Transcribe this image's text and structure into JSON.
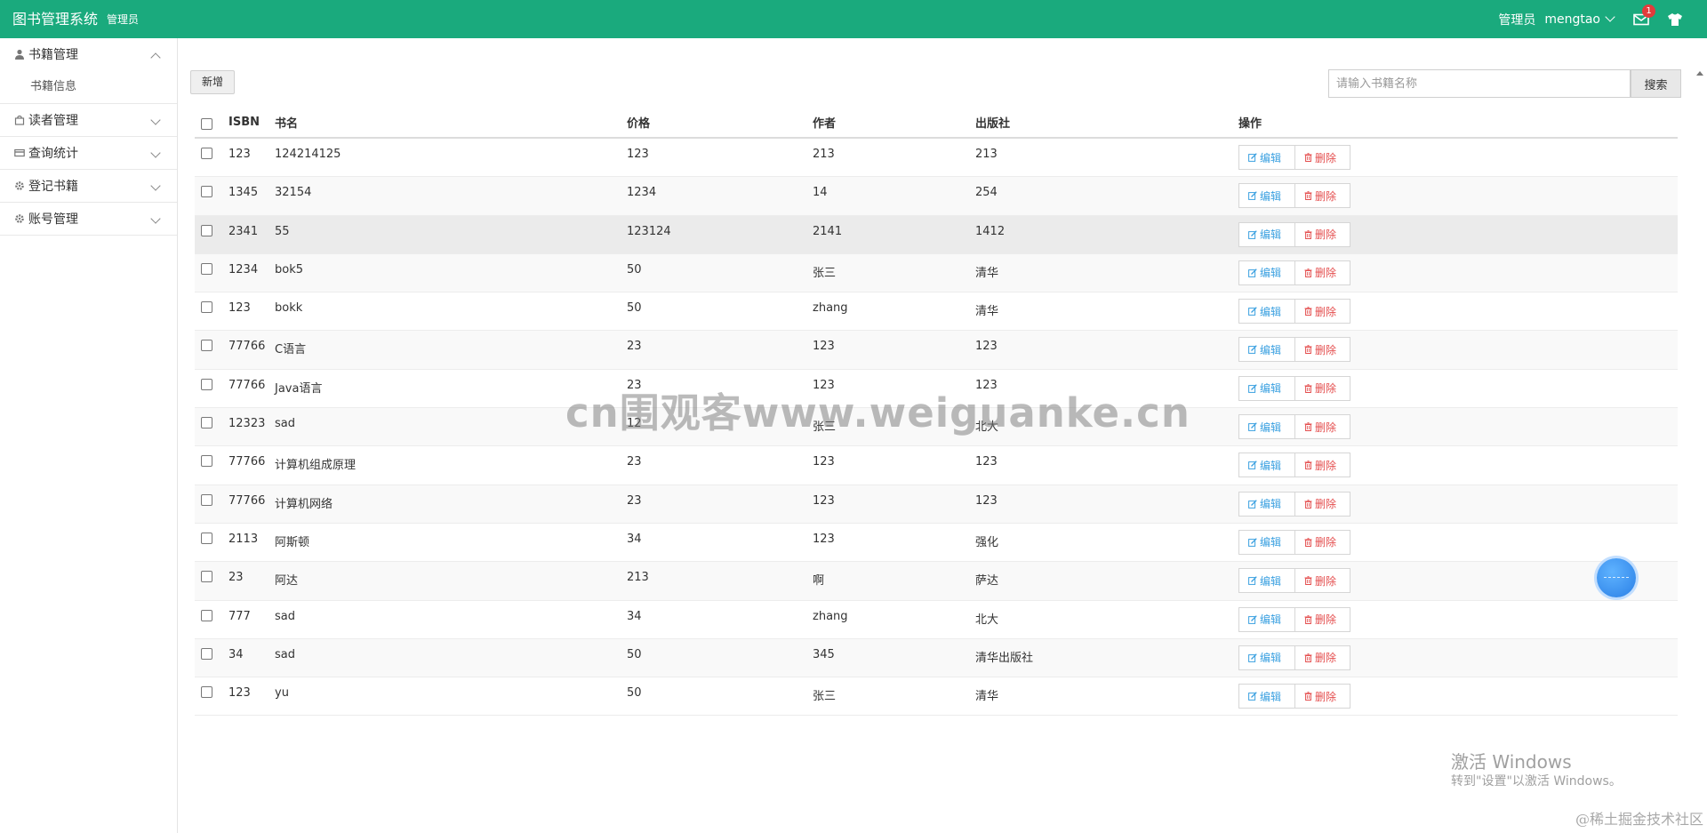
{
  "header": {
    "title": "图书管理系统",
    "subtitle": "管理员",
    "role": "管理员",
    "username": "mengtao",
    "mail_badge": "1",
    "bg_color": "#1aaa7d"
  },
  "sidebar": {
    "groups": [
      {
        "label": "书籍管理",
        "icon": "user-icon",
        "expanded": true,
        "items": [
          {
            "label": "书籍信息"
          }
        ]
      },
      {
        "label": "读者管理",
        "icon": "bag-icon",
        "expanded": false
      },
      {
        "label": "查询统计",
        "icon": "card-icon",
        "expanded": false
      },
      {
        "label": "登记书籍",
        "icon": "gear-icon",
        "expanded": false
      },
      {
        "label": "账号管理",
        "icon": "gear-icon",
        "expanded": false
      }
    ]
  },
  "toolbar": {
    "add_label": "新增",
    "search_placeholder": "请输入书籍名称",
    "search_label": "搜索"
  },
  "table": {
    "headers": {
      "isbn": "ISBN",
      "name": "书名",
      "price": "价格",
      "author": "作者",
      "publisher": "出版社",
      "ops": "操作"
    },
    "edit_label": "编辑",
    "delete_label": "删除",
    "rows": [
      {
        "isbn": "123",
        "name": "124214125",
        "price": "123",
        "author": "213",
        "publisher": "213"
      },
      {
        "isbn": "1345",
        "name": "32154",
        "price": "1234",
        "author": "14",
        "publisher": "254"
      },
      {
        "isbn": "2341",
        "name": "55",
        "price": "123124",
        "author": "2141",
        "publisher": "1412"
      },
      {
        "isbn": "1234",
        "name": "bok5",
        "price": "50",
        "author": "张三",
        "publisher": "清华"
      },
      {
        "isbn": "123",
        "name": "bokk",
        "price": "50",
        "author": "zhang",
        "publisher": "清华"
      },
      {
        "isbn": "77766",
        "name": "C语言",
        "price": "23",
        "author": "123",
        "publisher": "123"
      },
      {
        "isbn": "77766",
        "name": "Java语言",
        "price": "23",
        "author": "123",
        "publisher": "123"
      },
      {
        "isbn": "12323",
        "name": "sad",
        "price": "12",
        "author": "张三",
        "publisher": "北大"
      },
      {
        "isbn": "77766",
        "name": "计算机组成原理",
        "price": "23",
        "author": "123",
        "publisher": "123"
      },
      {
        "isbn": "77766",
        "name": "计算机网络",
        "price": "23",
        "author": "123",
        "publisher": "123"
      },
      {
        "isbn": "2113",
        "name": "阿斯顿",
        "price": "34",
        "author": "123",
        "publisher": "强化"
      },
      {
        "isbn": "23",
        "name": "阿达",
        "price": "213",
        "author": "啊",
        "publisher": "萨达"
      },
      {
        "isbn": "777",
        "name": "sad",
        "price": "34",
        "author": "zhang",
        "publisher": "北大"
      },
      {
        "isbn": "34",
        "name": "sad",
        "price": "50",
        "author": "345",
        "publisher": "清华出版社"
      },
      {
        "isbn": "123",
        "name": "yu",
        "price": "50",
        "author": "张三",
        "publisher": "清华"
      }
    ]
  },
  "overlays": {
    "watermark": "cn围观客www.weiguanke.cn",
    "windows_title": "激活 Windows",
    "windows_sub": "转到\"设置\"以激活 Windows。",
    "credit": "@稀土掘金技术社区"
  }
}
